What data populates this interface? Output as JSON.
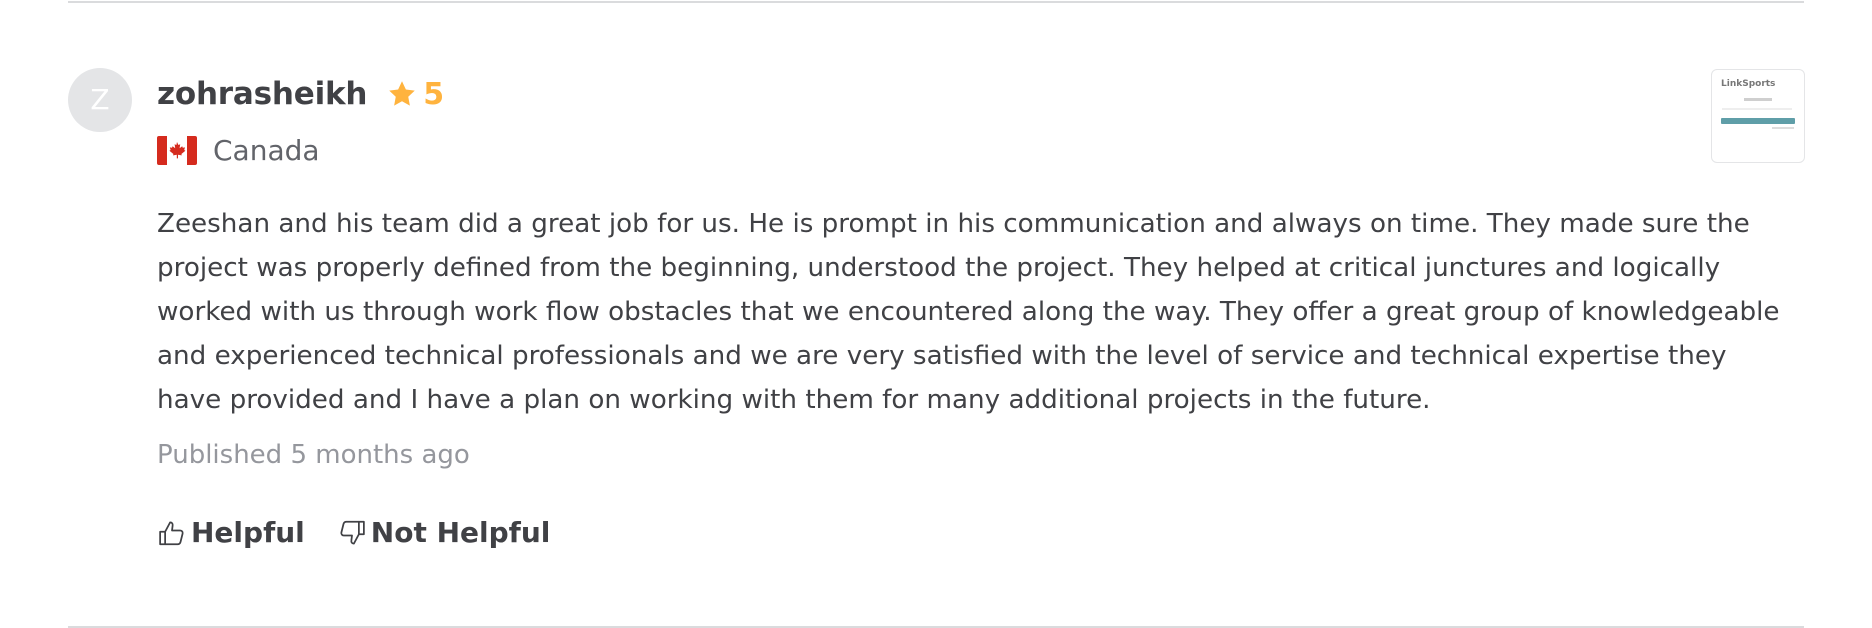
{
  "review": {
    "avatar_initial": "Z",
    "username": "zohrasheikh",
    "rating": "5",
    "country": "Canada",
    "thumbnail_text": "LinkSports",
    "text": "Zeeshan and his team did a great job for us. He is prompt in his communication and always on time. They made sure the project was properly defined from the beginning, understood the project. They helped at critical junctures and logically worked with us through work flow obstacles that we encountered along the way. They offer a great group of knowledgeable and experienced technical professionals and we are very satisfied with the level of service and technical expertise they have provided and I have a plan on working with them for many additional projects in the future.",
    "published": "Published 5 months ago",
    "helpful_label": "Helpful",
    "not_helpful_label": "Not Helpful"
  },
  "icons": {
    "rating": "star-icon",
    "country": "canada-flag-icon",
    "helpful": "thumbs-up-icon",
    "not_helpful": "thumbs-down-icon"
  },
  "colors": {
    "star": "#ffb33e",
    "text": "#404145",
    "muted": "#95979d",
    "divider": "#dadbdd",
    "avatar_bg": "#e4e5e7"
  }
}
